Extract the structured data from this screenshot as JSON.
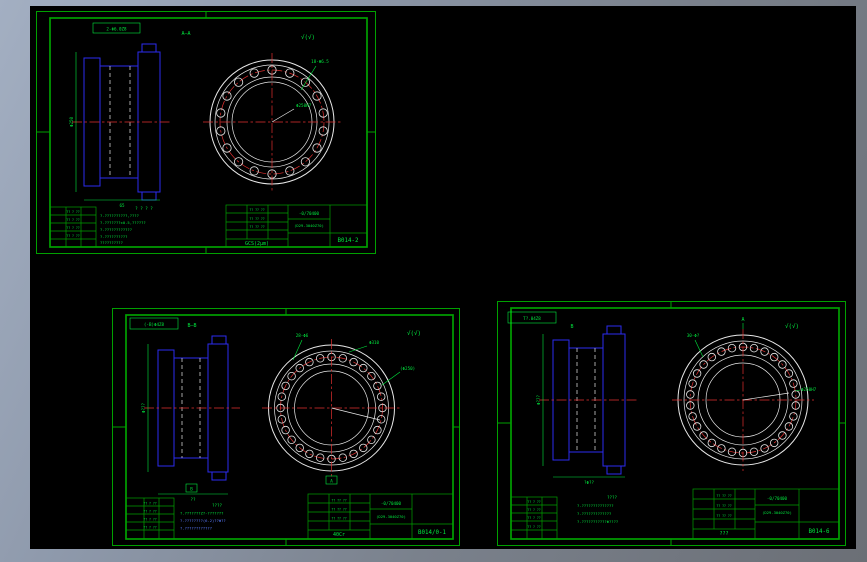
{
  "window": {
    "canvas_color": "#000000"
  },
  "palette": {
    "frame_green": "#00a000",
    "text_green": "#00e83e",
    "entity_blue": "#2b2bf0",
    "entity_white": "#e8e8e8",
    "centerline_red": "#e23030",
    "note_blue": "#5b7bff"
  },
  "drawings": [
    {
      "name": "bearing-cover-sheet-1",
      "corner_label": "2-Φ6.0Z8",
      "section_label": "A—A",
      "surface_mark": "√(√)",
      "side_view": {
        "dim_vertical": "Φ250",
        "dim_horizontal": "65"
      },
      "front_view": {
        "bolt_note": "18-Φ6.5",
        "bore_note": "Φ250H7"
      },
      "notes": [
        "? ? ? ?",
        "?.??????????,????",
        "?.???????±0.5,??????",
        "?.????????????",
        "?.??????????",
        "??????????"
      ],
      "title_block": {
        "code1": "-0/70400",
        "code2": "(D29-3040Z70)",
        "left_rows": [
          "?? ?? ??",
          "?? ?? ??",
          "?? ?? ??"
        ],
        "material": "GCS(2μm)",
        "part_no": "B014-2"
      },
      "rev_rows": [
        "?? ? ??",
        "?? ? ??",
        "?? ? ??",
        "?? ? ??"
      ]
    },
    {
      "name": "bearing-cover-sheet-2",
      "corner_label": "(-B)Φ4Z8",
      "section_label": "B—B",
      "surface_mark": "√(√)",
      "detail_letter": "B",
      "front_letter": "A",
      "side_view": {
        "dim_vertical": "Φ???",
        "dim_horizontal": "??"
      },
      "front_view": {
        "bolt_note": "28-Φ6",
        "od_note": "Φ310",
        "bore_note": "(Φ250)"
      },
      "notes": [
        "????",
        "?.???????Z?-???????",
        "?.????????(6-2)??Φ??",
        "?.????????????"
      ],
      "title_block": {
        "code1": "-0/70400",
        "code2": "(D29-3040Z70)",
        "left_rows": [
          "?? ?? ??",
          "?? ?? ??",
          "?? ?? ??"
        ],
        "material": "40Cr",
        "part_no": "B014/0-1"
      },
      "rev_rows": [
        "?? ? ??",
        "?? ? ??",
        "?? ? ??",
        "?? ? ??"
      ]
    },
    {
      "name": "bearing-cover-sheet-3",
      "corner_label": "T?.04Z8",
      "section_label": "B",
      "surface_mark": "√(√)",
      "front_letter": "A",
      "side_view": {
        "dim_vertical": "Φ???",
        "dim_horizontal": "?Φ??"
      },
      "front_view": {
        "bolt_note": "30-Φ?",
        "bore_note": "Φ250H7"
      },
      "notes": [
        "????",
        "?.??????????????",
        "?.?????????????",
        "?.???????????Φ????"
      ],
      "title_block": {
        "code1": "-0/70400",
        "code2": "(D29-3040Z70)",
        "left_rows": [
          "?? ?? ??",
          "?? ?? ??",
          "?? ?? ??"
        ],
        "material": "???",
        "part_no": "B014-6"
      },
      "rev_rows": [
        "?? ? ??",
        "?? ? ??",
        "?? ? ??",
        "?? ? ??"
      ]
    }
  ]
}
